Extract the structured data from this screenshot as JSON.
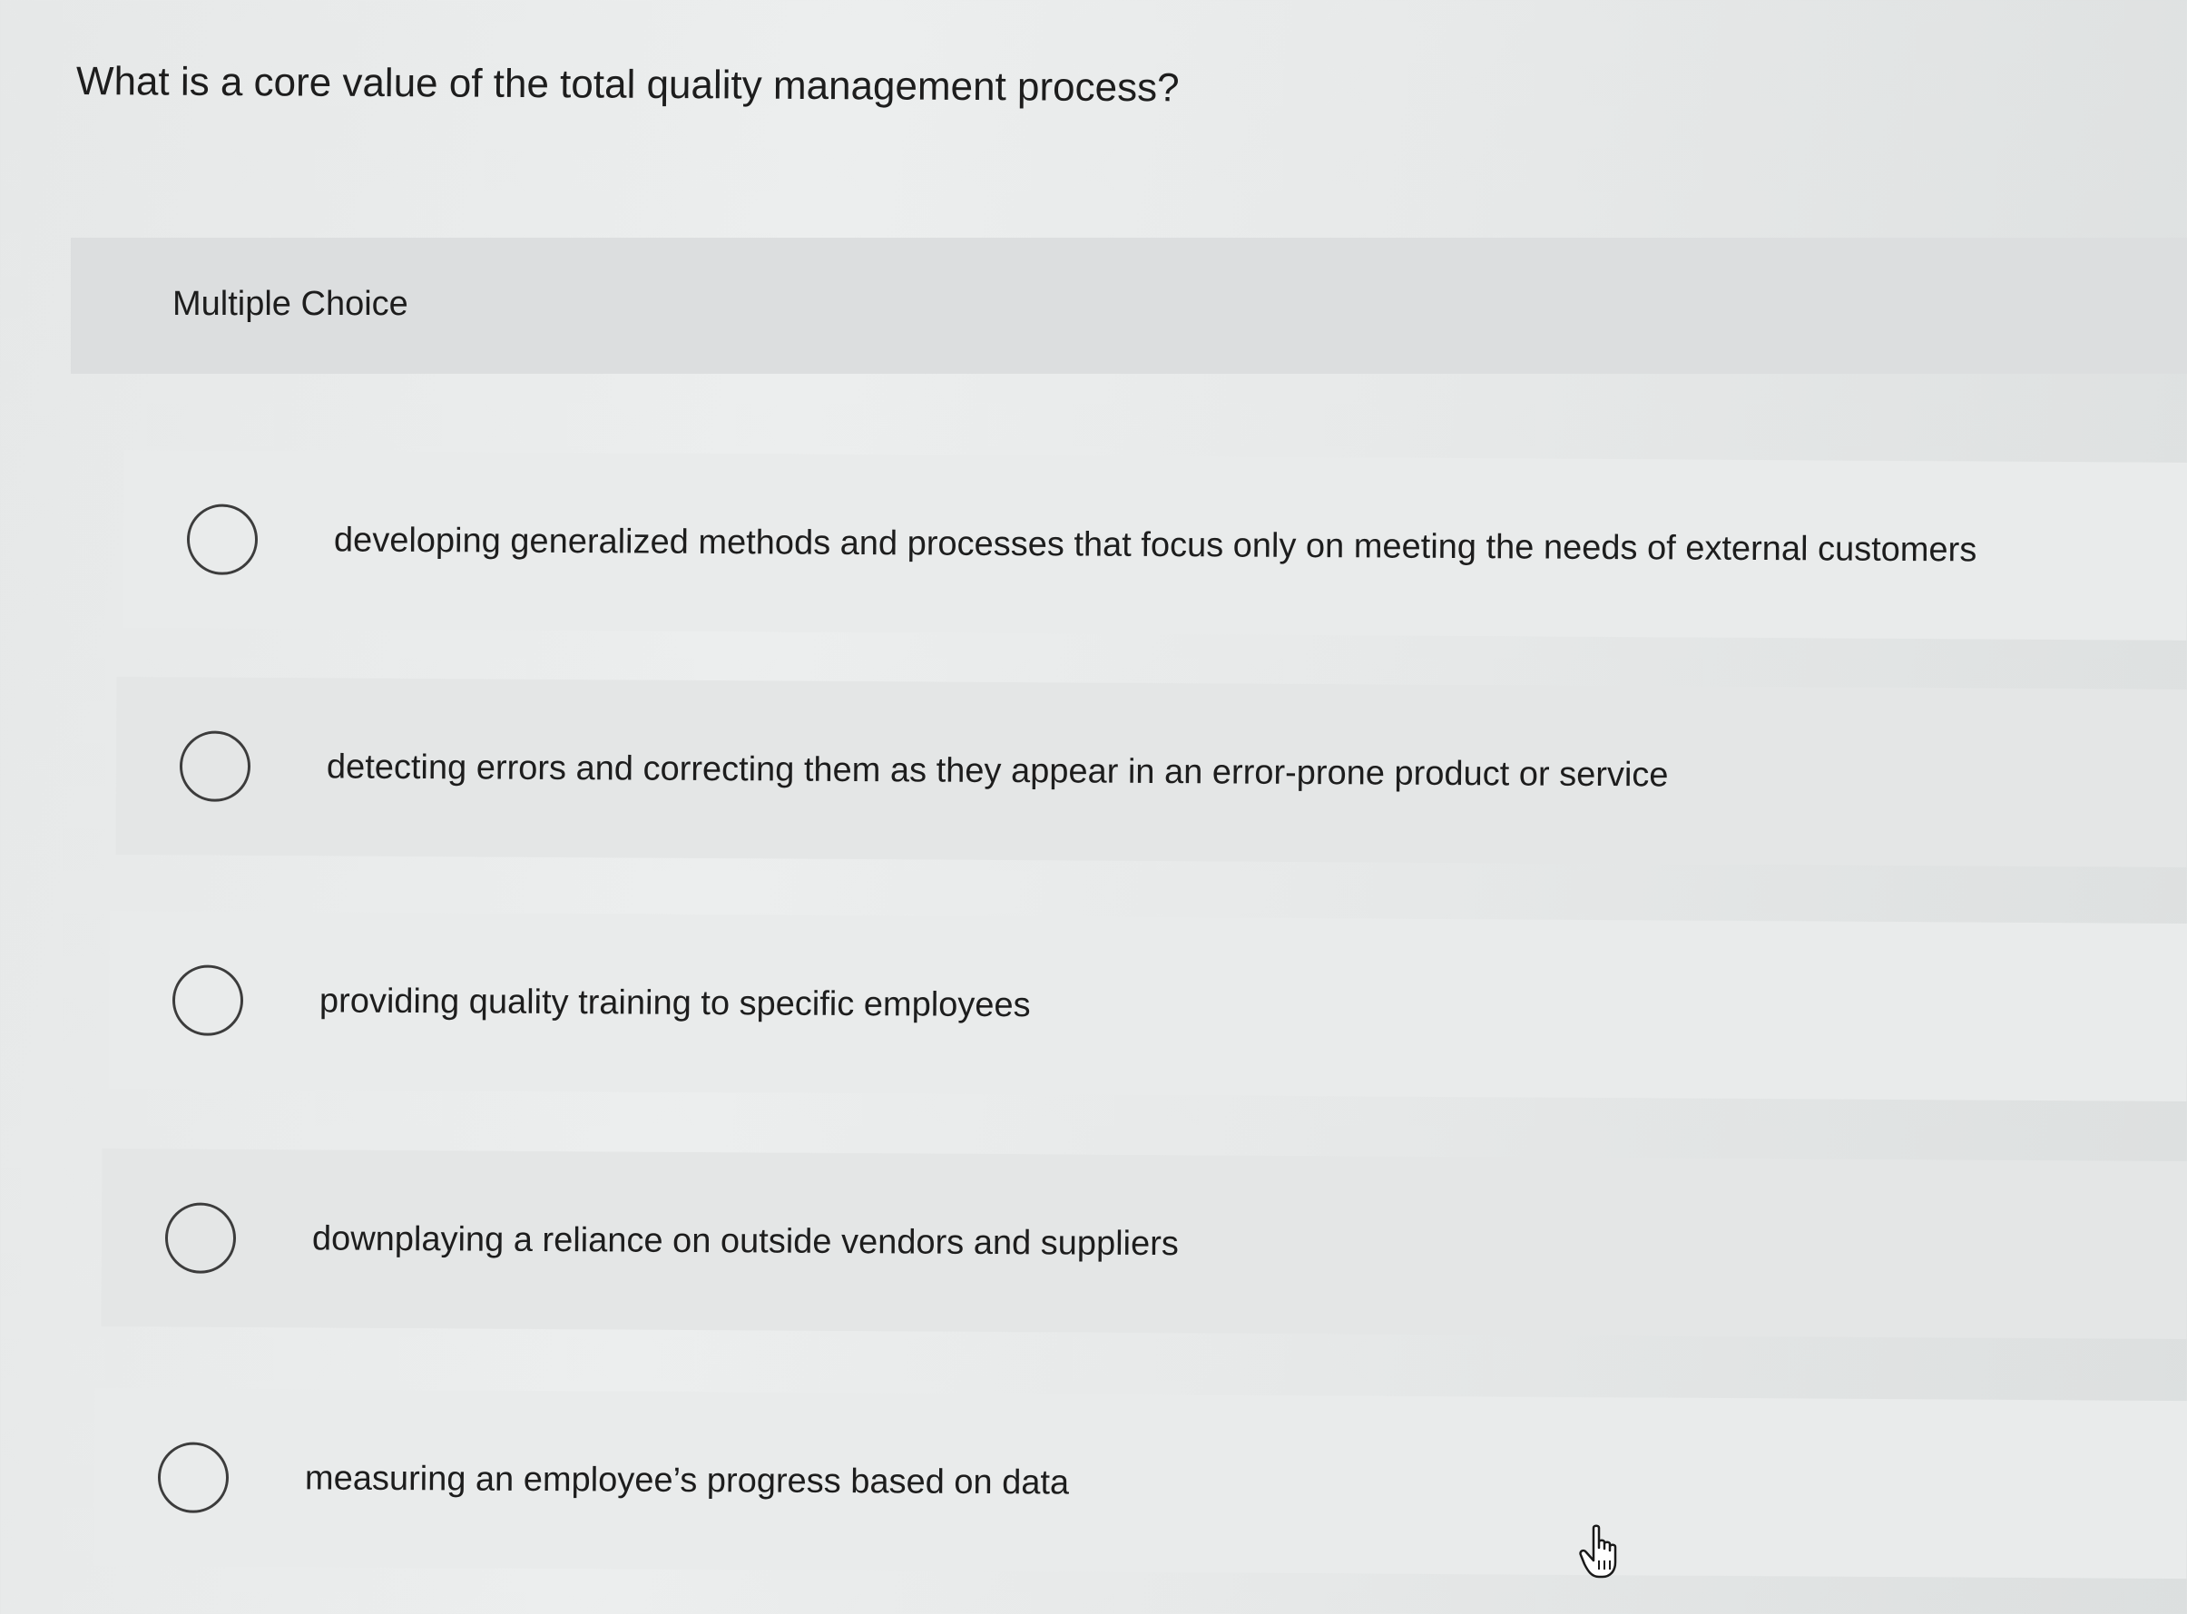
{
  "question": {
    "text": "What is a core value of the total quality management process?"
  },
  "question_type": {
    "label": "Multiple Choice"
  },
  "options": [
    {
      "label": "developing generalized methods and processes that focus only on meeting the needs of external customers",
      "selected": false
    },
    {
      "label": "detecting errors and correcting them as they appear in an error-prone product or service",
      "selected": false
    },
    {
      "label": "providing quality training to specific employees",
      "selected": false
    },
    {
      "label": "downplaying a reliance on outside vendors and suppliers",
      "selected": false
    },
    {
      "label": "measuring an employee’s progress based on data",
      "selected": false
    }
  ],
  "icons": {
    "radio": "radio-unselected-icon",
    "cursor": "hand-pointer-icon"
  },
  "colors": {
    "background": "#e8eaea",
    "header_band": "#dcdedf",
    "text": "#1d1d1d",
    "radio_border": "#3c3c3c"
  }
}
